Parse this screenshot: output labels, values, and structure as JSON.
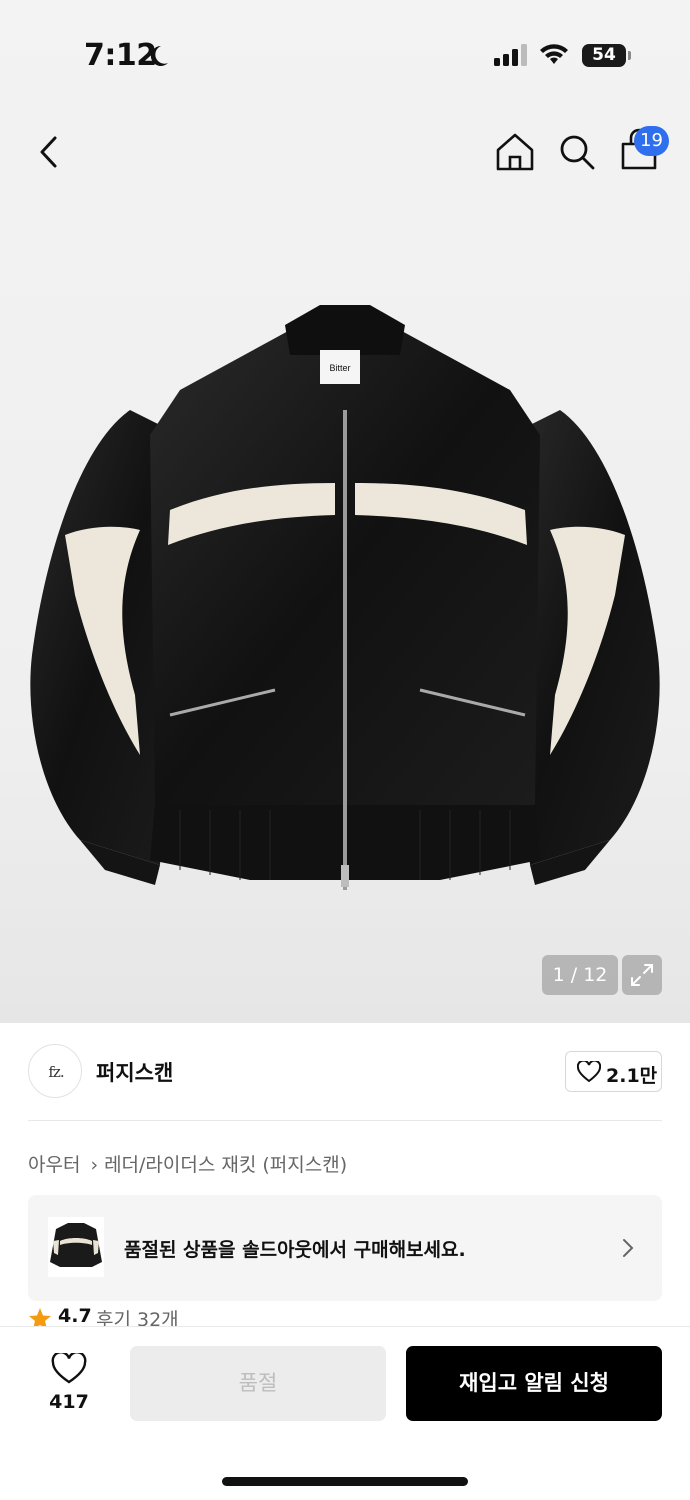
{
  "status_bar": {
    "time": "7:12",
    "battery": "54"
  },
  "header": {
    "cart_count": "19"
  },
  "gallery": {
    "counter": "1 / 12"
  },
  "product_image": {
    "brand_label": "Bitter"
  },
  "brand": {
    "name": "퍼지스캔",
    "logo_text": "fz.",
    "like_count": "2.1만"
  },
  "breadcrumb": {
    "category": "아우터",
    "subcategory": "레더/라이더스 재킷 (퍼지스캔)"
  },
  "soldout_banner": {
    "text": "품절된 상품을 솔드아웃에서 구매해보세요."
  },
  "rating": {
    "score": "4.7",
    "reviews": "후기 32개"
  },
  "bottom_bar": {
    "wish_count": "417",
    "soldout_label": "품절",
    "restock_label": "재입고 알림 신청"
  },
  "colors": {
    "accent_blue": "#2f6fee",
    "star": "#f39c12",
    "primary_button": "#000000",
    "disabled_button": "#ececec"
  }
}
